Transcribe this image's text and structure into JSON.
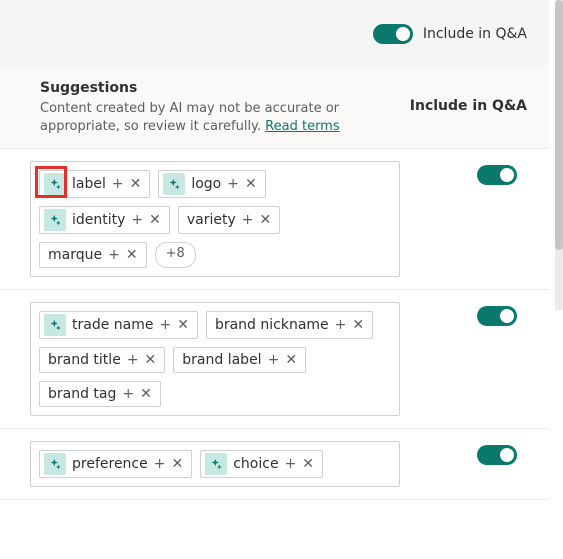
{
  "topBar": {
    "toggleLabel": "Include in Q&A"
  },
  "header": {
    "title": "Suggestions",
    "subtitle": "Content created by AI may not be accurate or appropriate, so review it carefully. ",
    "termsLink": "Read terms",
    "rightLabel": "Include in Q&A"
  },
  "groups": [
    {
      "overflow": "+8",
      "chips": [
        {
          "label": "label",
          "ai": true,
          "highlighted": true
        },
        {
          "label": "logo",
          "ai": true
        },
        {
          "label": "identity",
          "ai": true
        },
        {
          "label": "variety",
          "ai": false
        },
        {
          "label": "marque",
          "ai": false
        }
      ]
    },
    {
      "chips": [
        {
          "label": "trade name",
          "ai": true
        },
        {
          "label": "brand nickname",
          "ai": false
        },
        {
          "label": "brand title",
          "ai": false
        },
        {
          "label": "brand label",
          "ai": false
        },
        {
          "label": "brand tag",
          "ai": false
        }
      ]
    },
    {
      "chips": [
        {
          "label": "preference",
          "ai": true
        },
        {
          "label": "choice",
          "ai": true
        }
      ]
    }
  ]
}
